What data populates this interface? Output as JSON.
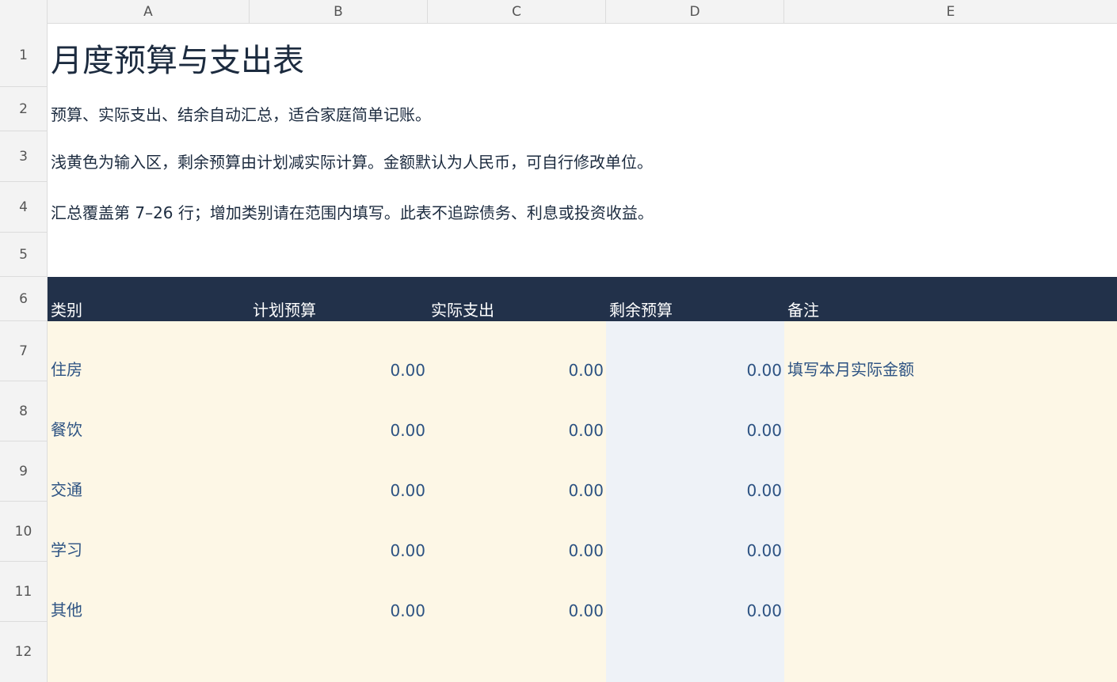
{
  "columns": [
    "A",
    "B",
    "C",
    "D",
    "E"
  ],
  "rows": [
    "1",
    "2",
    "3",
    "4",
    "5",
    "6",
    "7",
    "8",
    "9",
    "10",
    "11",
    "12"
  ],
  "sheet": {
    "title": "月度预算与支出表",
    "desc1": "预算、实际支出、结余自动汇总，适合家庭简单记账。",
    "desc2": "浅黄色为输入区，剩余预算由计划减实际计算。金额默认为人民币，可自行修改单位。",
    "desc3": "汇总覆盖第 7–26 行；增加类别请在范围内填写。此表不追踪债务、利息或投资收益。"
  },
  "table": {
    "headers": [
      "类别",
      "计划预算",
      "实际支出",
      "剩余预算",
      "备注"
    ],
    "rows": [
      {
        "category": "住房",
        "planned": "0.00",
        "actual": "0.00",
        "remaining": "0.00",
        "note": "填写本月实际金额"
      },
      {
        "category": "餐饮",
        "planned": "0.00",
        "actual": "0.00",
        "remaining": "0.00",
        "note": ""
      },
      {
        "category": "交通",
        "planned": "0.00",
        "actual": "0.00",
        "remaining": "0.00",
        "note": ""
      },
      {
        "category": "学习",
        "planned": "0.00",
        "actual": "0.00",
        "remaining": "0.00",
        "note": ""
      },
      {
        "category": "其他",
        "planned": "0.00",
        "actual": "0.00",
        "remaining": "0.00",
        "note": ""
      }
    ]
  },
  "colors": {
    "header_bg": "#22314a",
    "input_bg": "#fdf7e6",
    "calc_bg": "#eef2f7",
    "data_text": "#2c5282"
  }
}
